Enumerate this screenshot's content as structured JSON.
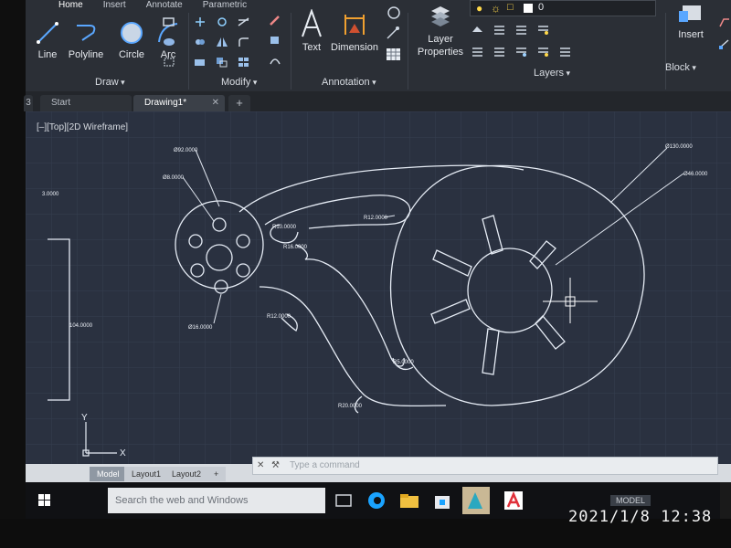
{
  "ribbon": {
    "tabs": [
      "Home",
      "Insert",
      "Annotate",
      "Parametric"
    ],
    "draw": {
      "line": "Line",
      "polyline": "Polyline",
      "circle": "Circle",
      "arc": "Arc",
      "group": "Draw"
    },
    "modify": {
      "group": "Modify"
    },
    "annotation": {
      "text": "Text",
      "dimension": "Dimension",
      "group": "Annotation"
    },
    "layers": {
      "layer_properties_line1": "Layer",
      "layer_properties_line2": "Properties",
      "group": "Layers",
      "current_layer": "0"
    },
    "block": {
      "insert": "Insert",
      "group": "Block"
    }
  },
  "doc_tabs": {
    "start": "Start",
    "drawing": "Drawing1*",
    "left_fragment": "3"
  },
  "viewport": {
    "label": "[–][Top][2D Wireframe]"
  },
  "drawing": {
    "dims": {
      "d92": "Ø92.0000",
      "d8": "Ø8.0000",
      "d130": "Ø130.0000",
      "d46": "Ø46.0000",
      "r10": "R10.0000",
      "r16": "R16.0000",
      "r12a": "R12.0000",
      "r12b": "R12.0000",
      "r5": "R5.0000",
      "r20": "R20.0000",
      "d16": "Ø16.0000",
      "v104": "104.0000",
      "v3": "3.0000"
    },
    "axis_y": "Y",
    "axis_x": "X"
  },
  "layout_tabs": [
    "Model",
    "Layout1",
    "Layout2"
  ],
  "command": {
    "placeholder": "Type a command"
  },
  "taskbar": {
    "search_placeholder": "Search the web and Windows",
    "model_label": "MODEL"
  },
  "timestamp": "2021/1/8  12:38",
  "colors": {
    "accent_blue": "#1aa3ff",
    "canvas_bg": "#2a3140",
    "drawing_line": "#e6ecf5",
    "ribbon_bg": "#2b2f36"
  }
}
